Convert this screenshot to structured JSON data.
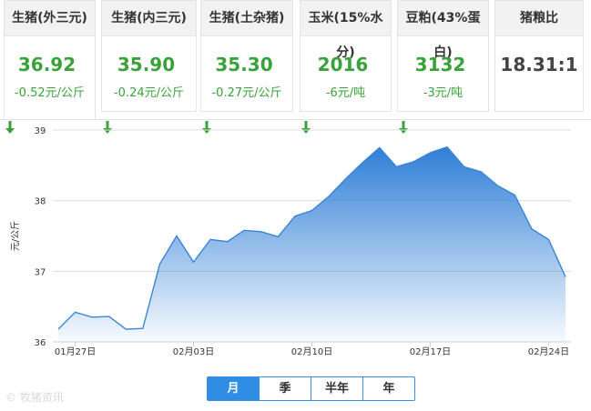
{
  "cards": [
    {
      "title": "生猪(外三元)",
      "price": "36.92",
      "change": "-0.52元/公斤",
      "direction": "down",
      "active": true
    },
    {
      "title": "生猪(内三元)",
      "price": "35.90",
      "change": "-0.24元/公斤",
      "direction": "down"
    },
    {
      "title": "生猪(土杂猪)",
      "price": "35.30",
      "change": "-0.27元/公斤",
      "direction": "down"
    },
    {
      "title": "玉米(15%水分)",
      "price": "2016",
      "change": "-6元/吨",
      "direction": "down"
    },
    {
      "title": "豆粕(43%蛋白)",
      "price": "3132",
      "change": "-3元/吨",
      "direction": "down"
    },
    {
      "title": "猪粮比",
      "price": "18.31:1",
      "change": "",
      "direction": "none"
    }
  ],
  "tabs": [
    {
      "label": "月",
      "active": true
    },
    {
      "label": "季"
    },
    {
      "label": "半年"
    },
    {
      "label": "年"
    }
  ],
  "watermark": "© 牧猪资讯",
  "colors": {
    "accent": "#2f8de4",
    "down": "#3aa23a",
    "line": "#3a84d8"
  },
  "chart_data": {
    "type": "area",
    "ylabel": "元/公斤",
    "ylim": [
      36,
      39
    ],
    "yticks": [
      36,
      37,
      38,
      39
    ],
    "xticks": [
      {
        "label": "01月27日",
        "index": 1
      },
      {
        "label": "02月03日",
        "index": 8
      },
      {
        "label": "02月10日",
        "index": 15
      },
      {
        "label": "02月17日",
        "index": 22
      },
      {
        "label": "02月24日",
        "index": 29
      }
    ],
    "grid": true,
    "series": [
      {
        "values": [
          36.18,
          36.42,
          36.35,
          36.36,
          36.18,
          36.19,
          37.1,
          37.5,
          37.13,
          37.45,
          37.42,
          37.58,
          37.56,
          37.49,
          37.78,
          37.86,
          38.06,
          38.31,
          38.54,
          38.75,
          38.48,
          38.55,
          38.68,
          38.76,
          38.48,
          38.41,
          38.21,
          38.08,
          37.6,
          37.45,
          36.92
        ]
      }
    ]
  }
}
